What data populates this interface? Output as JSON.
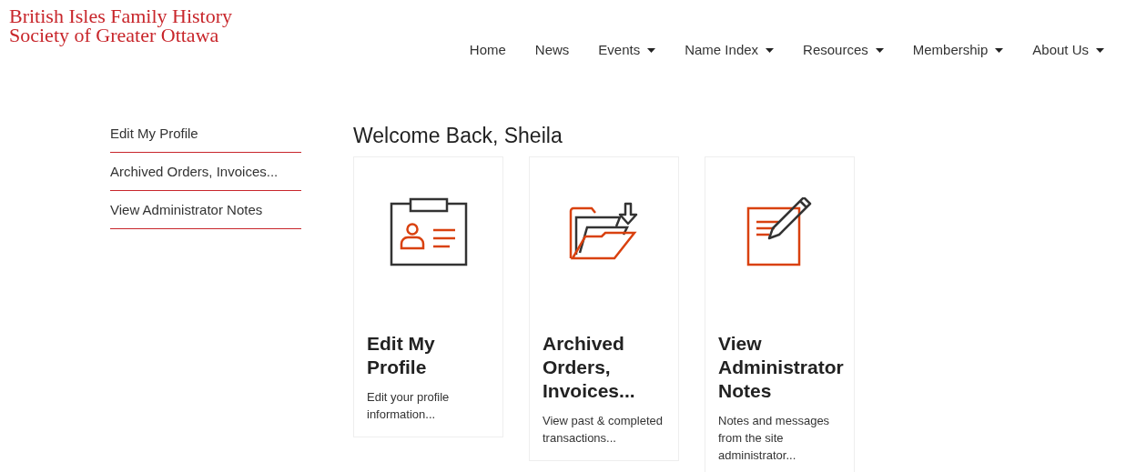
{
  "logo": {
    "lines": [
      "British Isles Family History",
      "Society of Greater Ottawa"
    ]
  },
  "nav": [
    {
      "label": "Home",
      "dropdown": false
    },
    {
      "label": "News",
      "dropdown": false
    },
    {
      "label": "Events",
      "dropdown": true
    },
    {
      "label": "Name Index",
      "dropdown": true
    },
    {
      "label": "Resources",
      "dropdown": true
    },
    {
      "label": "Membership",
      "dropdown": true
    },
    {
      "label": "About Us",
      "dropdown": true
    }
  ],
  "sidebar": {
    "items": [
      "Edit My Profile",
      "Archived Orders, Invoices...",
      "View Administrator Notes"
    ]
  },
  "heading": "Welcome Back, Sheila",
  "cards": [
    {
      "kind": "profile",
      "title": "Edit My Profile",
      "description": "Edit your profile information..."
    },
    {
      "kind": "folder",
      "title": "Archived Orders, Invoices...",
      "description": "View past & completed transactions..."
    },
    {
      "kind": "notes",
      "title": "View Administrator Notes",
      "description": "Notes and messages from the site administrator..."
    }
  ]
}
